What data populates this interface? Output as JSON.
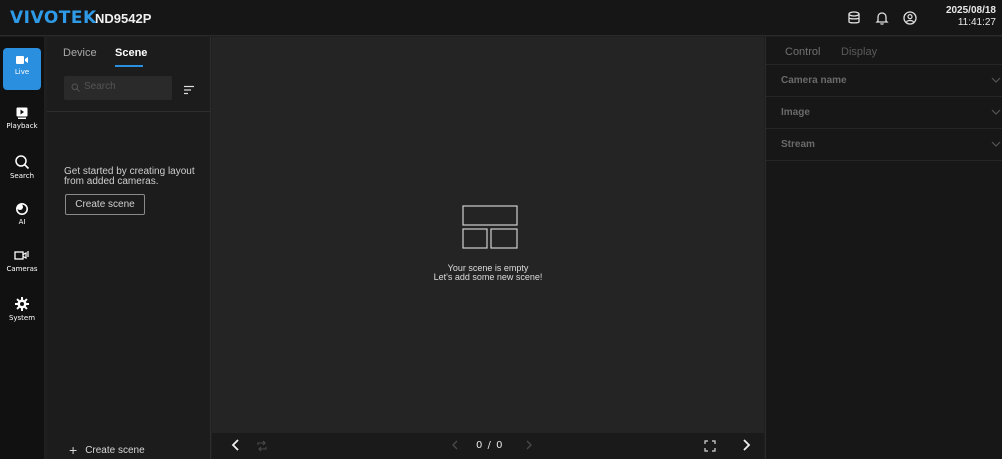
{
  "header": {
    "brand": "VIVOTEK",
    "model": "ND9542P",
    "date": "2025/08/18",
    "time": "11:41:27",
    "icons": [
      "storage-icon",
      "bell-icon",
      "account-icon"
    ],
    "brand_color": "#2f9be8"
  },
  "nav": {
    "accent_color": "#2b8fe0",
    "items": [
      {
        "label": "Live",
        "icon": "live-camera-icon",
        "active": true
      },
      {
        "label": "Playback",
        "icon": "playback-icon",
        "active": false
      },
      {
        "label": "Search",
        "icon": "search-icon",
        "active": false
      },
      {
        "label": "AI",
        "icon": "ai-icon",
        "active": false
      },
      {
        "label": "Cameras",
        "icon": "cameras-icon",
        "active": false
      },
      {
        "label": "System",
        "icon": "gear-icon",
        "active": false
      }
    ]
  },
  "scene_panel": {
    "tabs": [
      "Device",
      "Scene"
    ],
    "active_tab": "Scene",
    "search_placeholder": "Search",
    "hint_line1": "Get started by creating layout",
    "hint_line2": "from added cameras.",
    "create_button": "Create scene",
    "footer_button": "Create scene"
  },
  "main": {
    "empty_line1": "Your scene is empty",
    "empty_line2": "Let's add some new scene!",
    "page_indicator": "0 / 0"
  },
  "right_panel": {
    "tabs": [
      "Control",
      "Display"
    ],
    "sections": [
      "Camera name",
      "Image",
      "Stream"
    ]
  }
}
